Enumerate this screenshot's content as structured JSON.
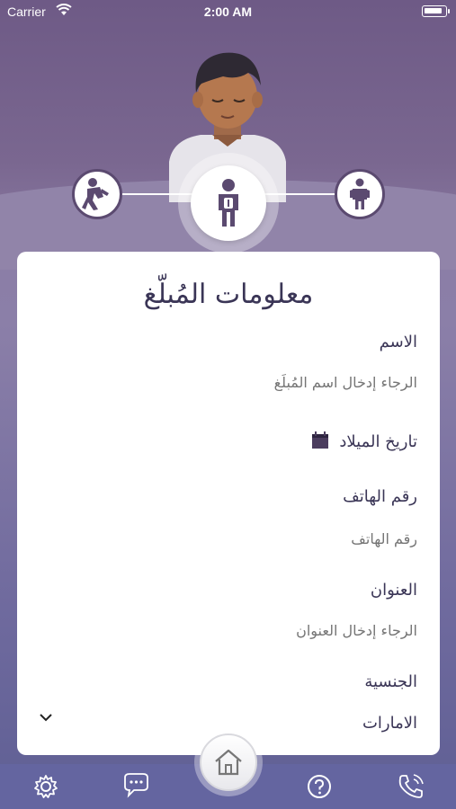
{
  "status_bar": {
    "carrier": "Carrier",
    "time": "2:00 AM"
  },
  "steps": {
    "active": "reporter"
  },
  "form": {
    "title": "معلومات المُبلّغ",
    "name_label": "الاسم",
    "name_placeholder": "الرجاء إدخال اسم المُبلِّغ",
    "birthdate_label": "تاريخ الميلاد",
    "phone_label": "رقم الهاتف",
    "phone_placeholder": "رقم الهاتف",
    "address_label": "العنوان",
    "address_placeholder": "الرجاء إدخال العنوان",
    "nationality_label": "الجنسية",
    "nationality_value": "الامارات"
  },
  "colors": {
    "accent": "#5b4a70",
    "bottom_bar": "#6465a0",
    "title_text": "#3a3556",
    "placeholder_text": "#b8b8b8"
  },
  "tab_bar": {
    "icons": [
      "gear-icon",
      "chat-icon",
      "home-icon",
      "help-icon",
      "phone-icon"
    ]
  }
}
